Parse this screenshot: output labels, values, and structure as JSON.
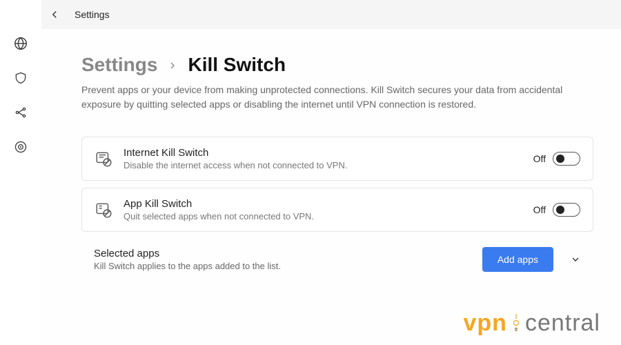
{
  "topbar": {
    "title": "Settings"
  },
  "breadcrumb": {
    "root": "Settings",
    "leaf": "Kill Switch"
  },
  "description": "Prevent apps or your device from making unprotected connections. Kill Switch secures your data from accidental exposure by quitting selected apps or disabling the internet until VPN connection is restored.",
  "cards": {
    "internet": {
      "title": "Internet Kill Switch",
      "sub": "Disable the internet access when not connected to VPN.",
      "state_label": "Off",
      "on": false
    },
    "app": {
      "title": "App Kill Switch",
      "sub": "Quit selected apps when not connected to VPN.",
      "state_label": "Off",
      "on": false
    }
  },
  "selected": {
    "title": "Selected apps",
    "sub": "Kill Switch applies to the apps added to the list.",
    "button": "Add apps"
  },
  "watermark": {
    "part1": "vpn",
    "part2": "central"
  }
}
